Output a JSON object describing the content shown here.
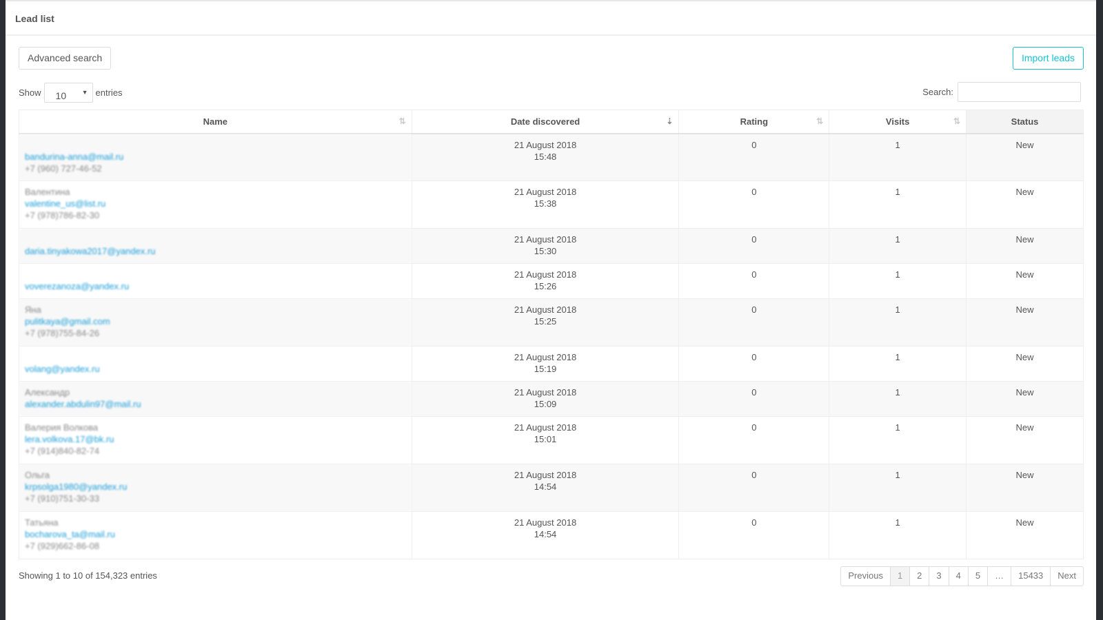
{
  "header": {
    "title": "Lead list"
  },
  "toolbar": {
    "advanced_search": "Advanced search",
    "import_leads": "Import leads",
    "accent": "#17c3d3"
  },
  "length": {
    "show": "Show",
    "value": "10",
    "entries": "entries"
  },
  "search": {
    "label": "Search:",
    "value": ""
  },
  "columns": [
    "Name",
    "Date discovered",
    "Rating",
    "Visits",
    "Status"
  ],
  "rows": [
    {
      "name": "",
      "email": "bandurina-anna@mail.ru",
      "phone": "+7 (960) 727-46-52",
      "date": "21 August 2018",
      "time": "15:48",
      "rating": "0",
      "visits": "1",
      "status": "New"
    },
    {
      "name": "Валентина",
      "email": "valentine_us@list.ru",
      "phone": "+7 (978)786-82-30",
      "date": "21 August 2018",
      "time": "15:38",
      "rating": "0",
      "visits": "1",
      "status": "New"
    },
    {
      "name": "",
      "email": "daria.tinyakowa2017@yandex.ru",
      "phone": "",
      "date": "21 August 2018",
      "time": "15:30",
      "rating": "0",
      "visits": "1",
      "status": "New"
    },
    {
      "name": "",
      "email": "voverezanoza@yandex.ru",
      "phone": "",
      "date": "21 August 2018",
      "time": "15:26",
      "rating": "0",
      "visits": "1",
      "status": "New"
    },
    {
      "name": "Яна",
      "email": "pulitkaya@gmail.com",
      "phone": "+7 (978)755-84-26",
      "date": "21 August 2018",
      "time": "15:25",
      "rating": "0",
      "visits": "1",
      "status": "New"
    },
    {
      "name": "",
      "email": "volang@yandex.ru",
      "phone": "",
      "date": "21 August 2018",
      "time": "15:19",
      "rating": "0",
      "visits": "1",
      "status": "New"
    },
    {
      "name": "Александр",
      "email": "alexander.abdulin97@mail.ru",
      "phone": "",
      "date": "21 August 2018",
      "time": "15:09",
      "rating": "0",
      "visits": "1",
      "status": "New"
    },
    {
      "name": "Валерия Волкова",
      "email": "lera.volkova.17@bk.ru",
      "phone": "+7 (914)840-82-74",
      "date": "21 August 2018",
      "time": "15:01",
      "rating": "0",
      "visits": "1",
      "status": "New"
    },
    {
      "name": "Ольга",
      "email": "krpsolga1980@yandex.ru",
      "phone": "+7 (910)751-30-33",
      "date": "21 August 2018",
      "time": "14:54",
      "rating": "0",
      "visits": "1",
      "status": "New"
    },
    {
      "name": "Татьяна",
      "email": "bocharova_ta@mail.ru",
      "phone": "+7 (929)662-86-08",
      "date": "21 August 2018",
      "time": "14:54",
      "rating": "0",
      "visits": "1",
      "status": "New"
    }
  ],
  "footer": {
    "info": "Showing 1 to 10 of 154,323 entries"
  },
  "pagination": [
    "Previous",
    "1",
    "2",
    "3",
    "4",
    "5",
    "…",
    "15433",
    "Next"
  ],
  "pagination_current": "1"
}
